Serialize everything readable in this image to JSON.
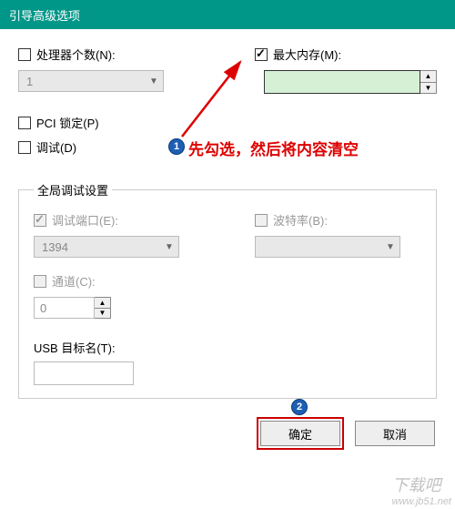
{
  "window": {
    "title": "引导高级选项"
  },
  "top": {
    "processors_label": "处理器个数(N):",
    "processors_value": "1",
    "max_memory_label": "最大内存(M):",
    "max_memory_value": "",
    "pci_lock_label": "PCI 锁定(P)",
    "debug_label": "调试(D)"
  },
  "annotation": {
    "text": "先勾选，然后将内容清空",
    "badge1": "1",
    "badge2": "2"
  },
  "global": {
    "legend": "全局调试设置",
    "debug_port_label": "调试端口(E):",
    "debug_port_value": "1394",
    "baud_label": "波特率(B):",
    "baud_value": "",
    "channel_label": "通道(C):",
    "channel_value": "0",
    "usb_label": "USB 目标名(T):",
    "usb_value": ""
  },
  "buttons": {
    "ok": "确定",
    "cancel": "取消"
  },
  "watermark": {
    "main": "下载吧",
    "sub": "www.jb51.net"
  }
}
